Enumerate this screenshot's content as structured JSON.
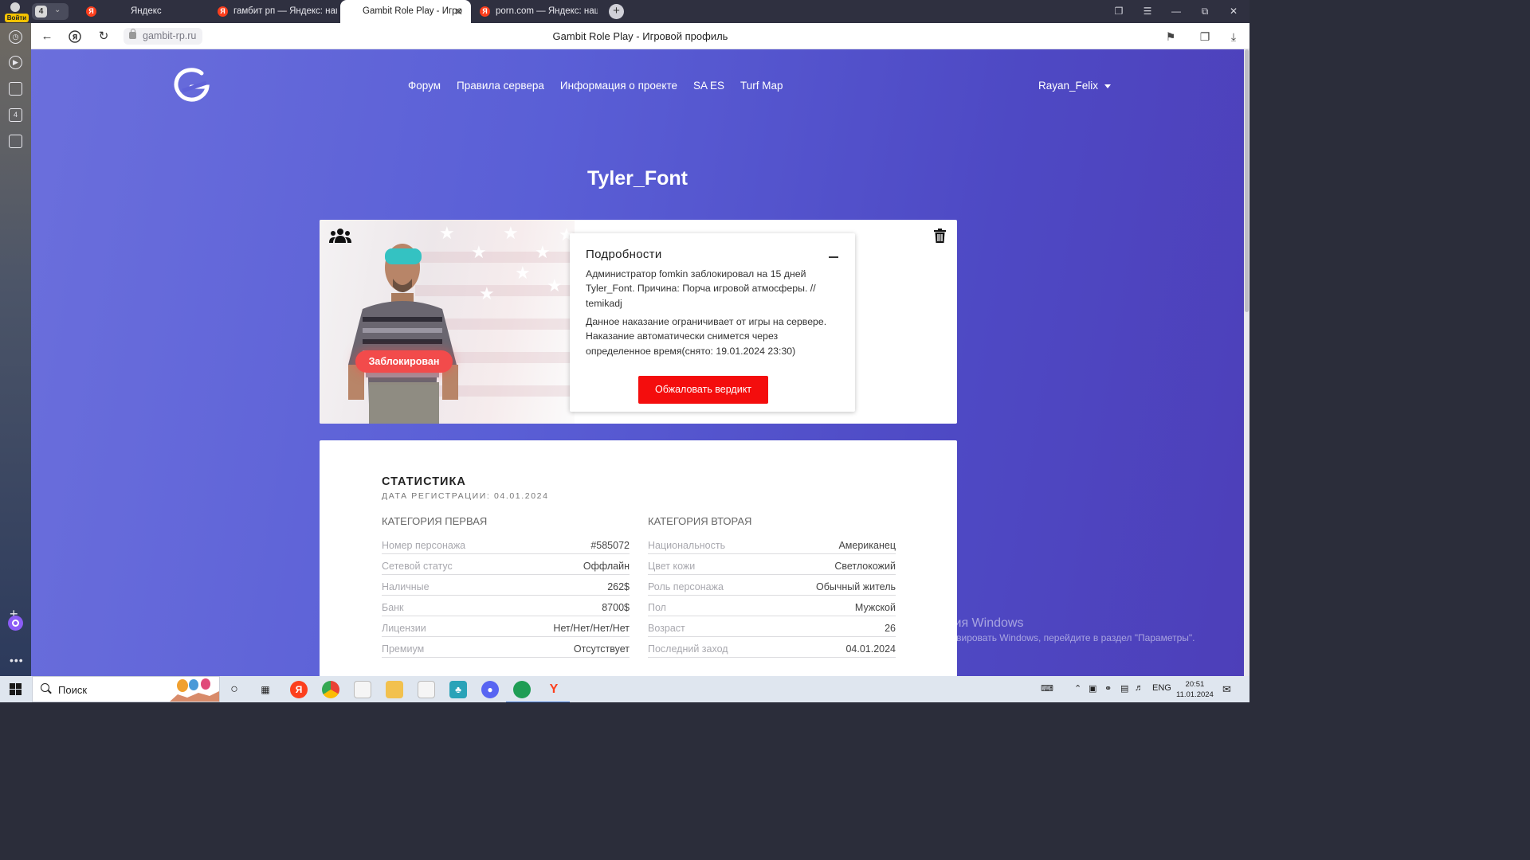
{
  "browser": {
    "profile_badge": "Войти",
    "tab_count": "4",
    "tabs": [
      {
        "title": "Яндекс",
        "favicon": "Я"
      },
      {
        "title": "гамбит рп — Яндекс: нашл",
        "favicon": "Я"
      },
      {
        "title": "Gambit Role Play - Игро",
        "favicon": "",
        "active": true
      },
      {
        "title": "porn.com — Яндекс: нашл",
        "favicon": "Я"
      }
    ],
    "url": "gambit-rp.ru",
    "page_title": "Gambit Role Play - Игровой профиль",
    "sidebar_counter": "4"
  },
  "site": {
    "nav": [
      "Форум",
      "Правила сервера",
      "Информация о проекте",
      "SA ES",
      "Turf Map"
    ],
    "user": "Rayan_Felix"
  },
  "profile": {
    "name": "Tyler_Font",
    "status_badge": "Заблокирован",
    "details": {
      "title": "Подробности",
      "ban_text": "Администратор fomkin заблокировал на 15 дней Tyler_Font. Причина: Порча игровой атмосферы. // temikadj",
      "note_text": "Данное наказание ограничивает от игры на сервере. Наказание автоматически снимется через определенное время(снято: 19.01.2024 23:30)",
      "appeal_button": "Обжаловать вердикт"
    }
  },
  "stats": {
    "title": "СТАТИСТИКА",
    "registration": "ДАТА РЕГИСТРАЦИИ: 04.01.2024",
    "category1": {
      "title": "КАТЕГОРИЯ ПЕРВАЯ",
      "rows": [
        {
          "key": "Номер персонажа",
          "value": "#585072"
        },
        {
          "key": "Сетевой статус",
          "value": "Оффлайн"
        },
        {
          "key": "Наличные",
          "value": "262$"
        },
        {
          "key": "Банк",
          "value": "8700$"
        },
        {
          "key": "Лицензии",
          "value": "Нет/Нет/Нет/Нет"
        },
        {
          "key": "Премиум",
          "value": "Отсутствует"
        }
      ]
    },
    "category2": {
      "title": "КАТЕГОРИЯ ВТОРАЯ",
      "rows": [
        {
          "key": "Национальность",
          "value": "Американец"
        },
        {
          "key": "Цвет кожи",
          "value": "Светлокожий"
        },
        {
          "key": "Роль персонажа",
          "value": "Обычный житель"
        },
        {
          "key": "Пол",
          "value": "Мужской"
        },
        {
          "key": "Возраст",
          "value": "26"
        },
        {
          "key": "Последний заход",
          "value": "04.01.2024"
        }
      ]
    }
  },
  "windows": {
    "activation_title": "Активация Windows",
    "activation_text": "Чтобы активировать Windows, перейдите в раздел \"Параметры\".",
    "search_placeholder": "Поиск",
    "lang": "ENG",
    "time": "20:51",
    "date": "11.01.2024"
  },
  "colors": {
    "page_gradient_start": "#6b6fdc",
    "page_gradient_end": "#4d3fb9",
    "ban_badge": "#f24b4b",
    "appeal_button": "#f40d0d"
  }
}
